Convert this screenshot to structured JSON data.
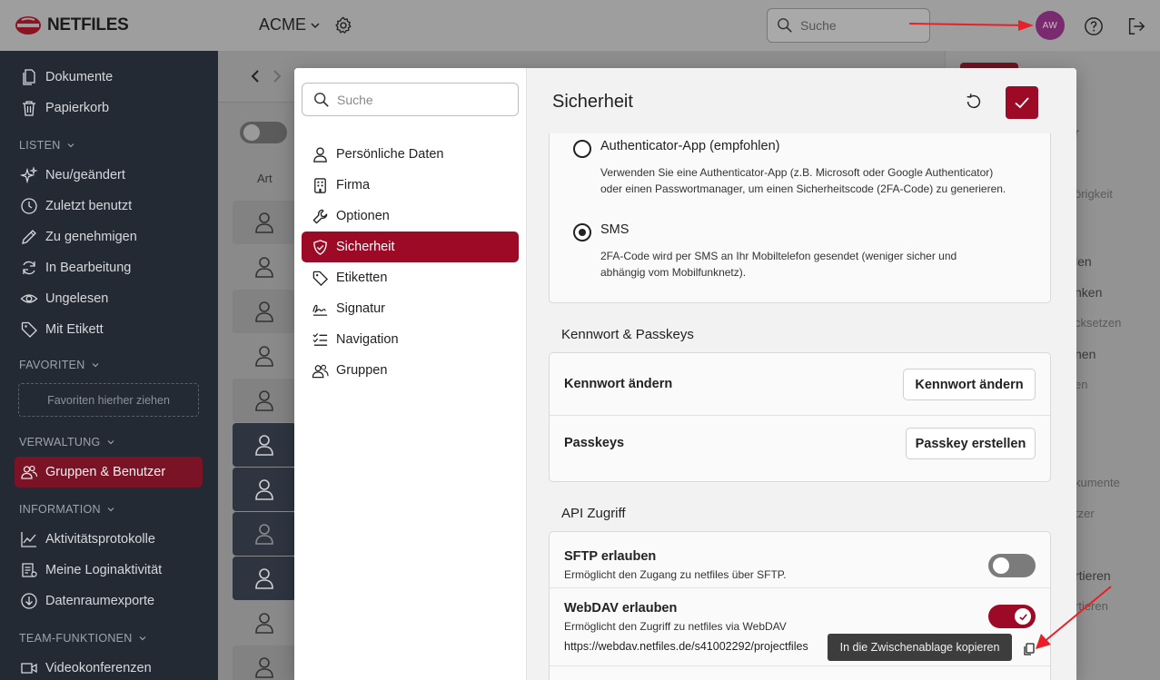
{
  "app": {
    "logo_text": "NETFILES",
    "company": "ACME",
    "search_placeholder": "Suche",
    "avatar_initials": "AW"
  },
  "leftnav": {
    "items_top": [
      {
        "label": "Dokumente",
        "icon": "documents-icon"
      },
      {
        "label": "Papierkorb",
        "icon": "trash-icon"
      }
    ],
    "listen_header": "LISTEN",
    "listen_items": [
      {
        "label": "Neu/geändert",
        "icon": "sparkle-icon"
      },
      {
        "label": "Zuletzt benutzt",
        "icon": "clock-icon"
      },
      {
        "label": "Zu genehmigen",
        "icon": "pen-icon"
      },
      {
        "label": "In Bearbeitung",
        "icon": "refresh-icon"
      },
      {
        "label": "Ungelesen",
        "icon": "eye-icon"
      },
      {
        "label": "Mit Etikett",
        "icon": "tag-icon"
      }
    ],
    "favoriten_header": "FAVORITEN",
    "favoriten_drop": "Favoriten hierher ziehen",
    "verwaltung_header": "VERWALTUNG",
    "verwaltung_items": [
      {
        "label": "Gruppen & Benutzer",
        "icon": "users-icon"
      }
    ],
    "information_header": "INFORMATION",
    "information_items": [
      {
        "label": "Aktivitätsprotokolle",
        "icon": "activity-chart-icon"
      },
      {
        "label": "Meine Loginaktivität",
        "icon": "login-list-icon"
      },
      {
        "label": "Datenraumexporte",
        "icon": "download-circle-icon"
      }
    ],
    "team_header": "TEAM-FUNKTIONEN",
    "team_items": [
      {
        "label": "Videokonferenzen",
        "icon": "video-icon"
      }
    ]
  },
  "background": {
    "column_art": "Art",
    "right_panel_items": [
      "r",
      "örigkeit",
      "len",
      "nken",
      "cksetzen",
      "nen",
      "en",
      "kumente",
      "tzer",
      "rtieren",
      "rtieren"
    ]
  },
  "modal": {
    "search_placeholder": "Suche",
    "side_items": [
      {
        "label": "Persönliche Daten",
        "icon": "person-icon"
      },
      {
        "label": "Firma",
        "icon": "building-icon"
      },
      {
        "label": "Optionen",
        "icon": "wrench-icon"
      },
      {
        "label": "Sicherheit",
        "icon": "shield-icon"
      },
      {
        "label": "Etiketten",
        "icon": "tag-icon"
      },
      {
        "label": "Signatur",
        "icon": "signature-icon"
      },
      {
        "label": "Navigation",
        "icon": "list-icon"
      },
      {
        "label": "Gruppen",
        "icon": "group-icon"
      }
    ],
    "active_side_item": "Sicherheit",
    "title": "Sicherheit",
    "twofa": {
      "option_app_label": "Authenticator-App (empfohlen)",
      "option_app_desc": "Verwenden Sie eine Authenticator-App (z.B. Microsoft oder Google Authenticator) oder einen Passwortmanager, um einen Sicherheitscode (2FA-Code) zu generieren.",
      "option_sms_label": "SMS",
      "option_sms_desc": "2FA-Code wird per SMS an Ihr Mobiltelefon gesendet (weniger sicher und abhängig vom Mobilfunknetz).",
      "selected": "SMS"
    },
    "password_section": {
      "title": "Kennwort & Passkeys",
      "change_label": "Kennwort ändern",
      "change_button": "Kennwort ändern",
      "passkeys_label": "Passkeys",
      "passkeys_button": "Passkey erstellen"
    },
    "api_section": {
      "title": "API Zugriff",
      "sftp_label": "SFTP erlauben",
      "sftp_desc": "Ermöglicht den Zugang zu netfiles über SFTP.",
      "sftp_enabled": false,
      "webdav_label": "WebDAV erlauben",
      "webdav_desc": "Ermöglicht den Zugriff zu netfiles via WebDAV",
      "webdav_enabled": true,
      "webdav_url": "https://webdav.netfiles.de/s41002292/projectfiles",
      "copy_tooltip": "In die Zwischenablage kopieren"
    }
  },
  "colors": {
    "accent": "#9c0a26",
    "nav_bg": "#242a34",
    "annotation_arrow": "#e8202a"
  }
}
